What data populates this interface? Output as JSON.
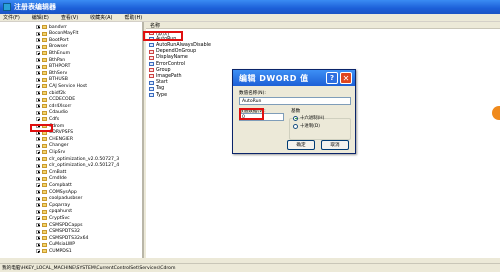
{
  "window": {
    "title": "注册表编辑器"
  },
  "menu": [
    "文件(F)",
    "编辑(E)",
    "查看(V)",
    "收藏夹(A)",
    "帮助(H)"
  ],
  "tree": {
    "items": [
      "bandvrr",
      "BoconMayFlt",
      "BootPort",
      "Browser",
      "BthEnum",
      "BthPan",
      "BTHPORT",
      "BthServ",
      "BTHUSB",
      "CAJ Service Host",
      "cbidf2k",
      "CCDECODE",
      "cdr4Xsorr",
      "Cdaudio",
      "Cdfs",
      "Cdrom",
      "CDRVPSFS",
      "CHENGIER",
      "Changer",
      "ClipSrv",
      "clr_optimization_v2.0.50727_3",
      "clr_optimization_v2.0.50127_4",
      "CmBatt",
      "CmdIde",
      "Compbatt",
      "COMSysApp",
      "coolpadusbser",
      "Cpqarray",
      "cpqahurst",
      "CryptSvc",
      "CSMSPDCapps",
      "CSMSPDTS32",
      "CSMSPDTS32x64",
      "CuMsiaLWP",
      "CUMPDS1"
    ]
  },
  "list": {
    "column_name": "名称",
    "items": [
      {
        "name": "(默认)",
        "type": "sz"
      },
      {
        "name": "AutoRun",
        "type": "dword"
      },
      {
        "name": "AutoRunAlwaysDisable",
        "type": "dword"
      },
      {
        "name": "DependOnGroup",
        "type": "sz"
      },
      {
        "name": "DisplayName",
        "type": "sz"
      },
      {
        "name": "ErrorControl",
        "type": "dword"
      },
      {
        "name": "Group",
        "type": "sz"
      },
      {
        "name": "ImagePath",
        "type": "sz"
      },
      {
        "name": "Start",
        "type": "dword"
      },
      {
        "name": "Tag",
        "type": "dword"
      },
      {
        "name": "Type",
        "type": "dword"
      }
    ]
  },
  "dialog": {
    "title": "编辑 DWORD 值",
    "value_name_label": "数值名称(N):",
    "value_name": "AutoRun",
    "value_data_label": "数值数据(V):",
    "value_data": "0",
    "base_label": "基数",
    "hex_label": "十六进制(H)",
    "dec_label": "十进制(D)",
    "ok_label": "确定",
    "cancel_label": "取消",
    "help_glyph": "?",
    "close_glyph": "✕"
  },
  "status": {
    "path": "我的电脑\\HKEY_LOCAL_MACHINE\\SYSTEM\\CurrentControlSet\\Services\\Cdrom"
  },
  "colors": {
    "highlight": "#e01010",
    "titlebar": "#1c5fd8"
  }
}
